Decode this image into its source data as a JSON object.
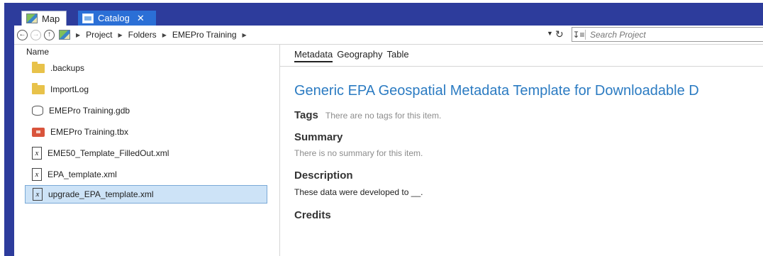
{
  "tabs": [
    {
      "label": "Map",
      "icon": "map-icon"
    },
    {
      "label": "Catalog",
      "icon": "catalog-icon",
      "close": "✕"
    }
  ],
  "address": {
    "crumbs": [
      "Project",
      "Folders",
      "EMEPro Training"
    ],
    "search_placeholder": "Search Project"
  },
  "left_pane": {
    "column_header": "Name",
    "items": [
      {
        "label": ".backups",
        "icon": "folder-icon"
      },
      {
        "label": "ImportLog",
        "icon": "folder-icon"
      },
      {
        "label": "EMEPro Training.gdb",
        "icon": "geodatabase-icon"
      },
      {
        "label": "EMEPro Training.tbx",
        "icon": "toolbox-icon"
      },
      {
        "label": "EME50_Template_FilledOut.xml",
        "icon": "xml-file-icon"
      },
      {
        "label": "EPA_template.xml",
        "icon": "xml-file-icon"
      },
      {
        "label": "upgrade_EPA_template.xml",
        "icon": "xml-file-icon",
        "selected": true
      }
    ]
  },
  "right_pane": {
    "tabs": [
      "Metadata",
      "Geography",
      "Table"
    ],
    "active_tab": "Metadata",
    "title": "Generic EPA Geospatial Metadata Template for Downloadable D",
    "tags_label": "Tags",
    "tags_text": "There are no tags for this item.",
    "summary_label": "Summary",
    "summary_text": "There is no summary for this item.",
    "description_label": "Description",
    "description_text": "These data were developed to __.",
    "credits_label": "Credits"
  },
  "colors": {
    "frame": "#2d3c9c",
    "active_tab": "#2b6fd6",
    "selection": "#cde3f7",
    "title_link": "#2b7bc2"
  }
}
